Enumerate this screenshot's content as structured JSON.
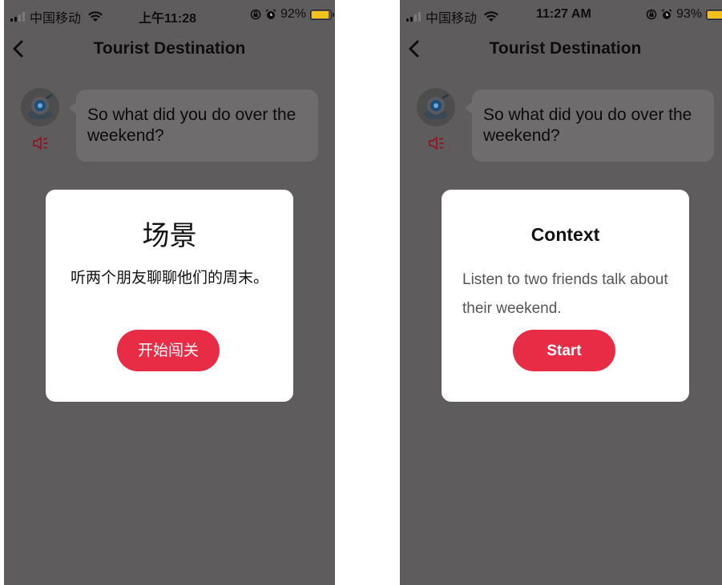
{
  "colors": {
    "overlay_background": "#5e5c5d",
    "modal_background": "#ffffff",
    "primary_button": "#e82c45",
    "battery": "#f2c11b"
  },
  "icons": {
    "back": "chevron-left-icon",
    "speaker": "speaker-icon",
    "avatar": "robot-avatar",
    "wifi": "wifi-icon",
    "alarm": "alarm-icon",
    "rotation_lock": "rotation-lock-icon"
  },
  "screens": [
    {
      "status_bar": {
        "carrier": "中国移动",
        "time": "上午11:28",
        "battery_text": "92%",
        "battery_level": 0.92
      },
      "nav": {
        "title": "Tourist Destination"
      },
      "chat": {
        "message": "So what did you do over the weekend?"
      },
      "modal": {
        "title": "场景",
        "body": "听两个朋友聊聊他们的周末。",
        "button": "开始闯关"
      }
    },
    {
      "status_bar": {
        "carrier": "中国移动",
        "time": "11:27 AM",
        "battery_text": "93%",
        "battery_level": 0.93
      },
      "nav": {
        "title": "Tourist Destination"
      },
      "chat": {
        "message": "So what did you do over the weekend?"
      },
      "modal": {
        "title": "Context",
        "body": "Listen to two friends talk about their weekend.",
        "button": "Start"
      }
    }
  ]
}
